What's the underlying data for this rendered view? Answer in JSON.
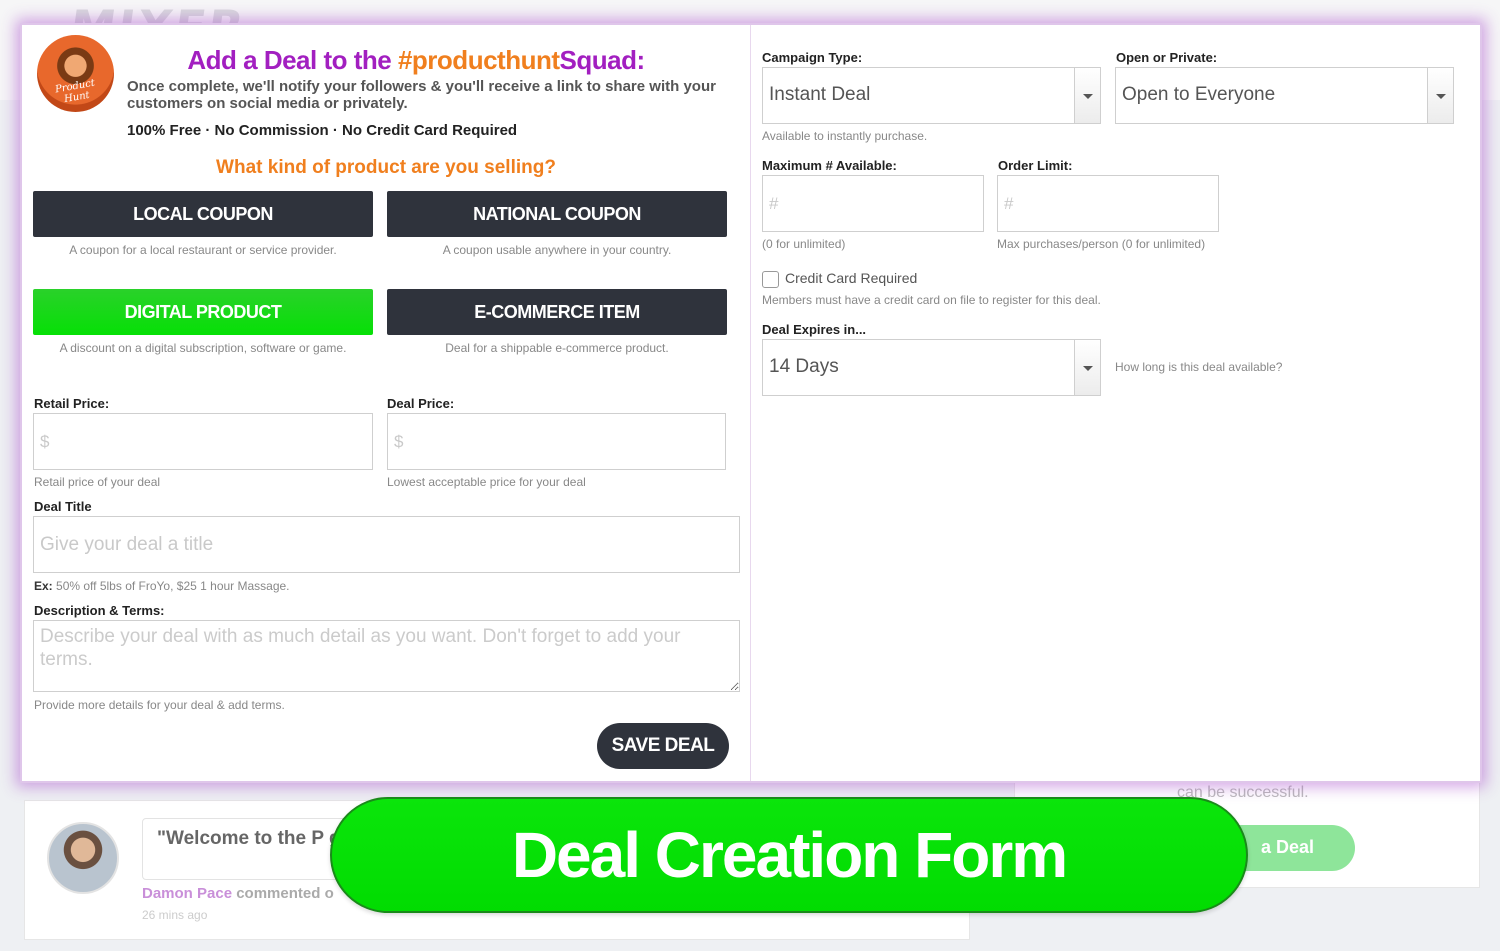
{
  "background": {
    "logo": "MIXER",
    "feed_quote": "\"Welcome to the P get deals together",
    "feed_user": "Damon Pace",
    "feed_action": "commented o",
    "feed_time": "26 mins ago",
    "side_text": "can be successful.",
    "side_button": "a Deal"
  },
  "header": {
    "logo_text": "Product Hunt",
    "title_prefix": "Add a Deal to the",
    "title_highlight": "#producthunt",
    "title_suffix": "Squad:",
    "subtitle": "Once complete, we'll notify your followers & you'll receive a link to share with your customers on social media or privately.",
    "free_line": "100% Free · No Commission · No Credit Card Required"
  },
  "product_types": {
    "question": "What kind of product are you selling?",
    "items": [
      {
        "label": "LOCAL COUPON",
        "desc": "A coupon for a local restaurant or service provider."
      },
      {
        "label": "NATIONAL COUPON",
        "desc": "A coupon usable anywhere in your country."
      },
      {
        "label": "DIGITAL PRODUCT",
        "desc": "A discount on a digital subscription, software or game."
      },
      {
        "label": "E-COMMERCE ITEM",
        "desc": "Deal for a shippable e-commerce product."
      }
    ]
  },
  "form": {
    "retail_price": {
      "label": "Retail Price:",
      "placeholder": "$",
      "help": "Retail price of your deal"
    },
    "deal_price": {
      "label": "Deal Price:",
      "placeholder": "$",
      "help": "Lowest acceptable price for your deal"
    },
    "deal_title": {
      "label": "Deal Title",
      "placeholder": "Give your deal a title",
      "help_prefix": "Ex:",
      "help": "50% off 5lbs of FroYo, $25 1 hour Massage."
    },
    "description": {
      "label": "Description & Terms:",
      "placeholder": "Describe your deal with as much detail as you want. Don't forget to add your terms.",
      "help": "Provide more details for your deal & add terms."
    },
    "save_label": "SAVE DEAL"
  },
  "settings": {
    "campaign_type": {
      "label": "Campaign Type:",
      "value": "Instant Deal",
      "help": "Available to instantly purchase."
    },
    "visibility": {
      "label": "Open or Private:",
      "value": "Open to Everyone"
    },
    "max_available": {
      "label": "Maximum # Available:",
      "placeholder": "#",
      "help": "(0 for unlimited)"
    },
    "order_limit": {
      "label": "Order Limit:",
      "placeholder": "#",
      "help": "Max purchases/person (0 for unlimited)"
    },
    "credit_card": {
      "label": "Credit Card Required",
      "help": "Members must have a credit card on file to register for this deal."
    },
    "expires": {
      "label": "Deal Expires in...",
      "value": "14 Days",
      "help": "How long is this deal available?"
    }
  },
  "banner": {
    "text": "Deal Creation Form"
  },
  "colors": {
    "accent_purple": "#a21fc0",
    "accent_orange": "#f07f1e",
    "active_green": "#06e006",
    "dark_button": "#2f333c"
  }
}
